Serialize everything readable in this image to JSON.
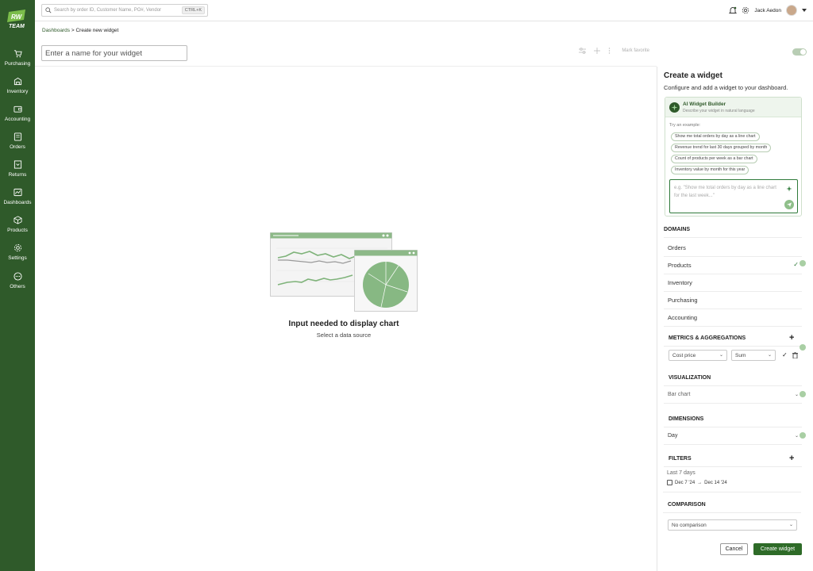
{
  "brand": {
    "logo_text_top": "RW",
    "logo_text_bottom": "TEAM",
    "accent_color": "#2f5a2a"
  },
  "sidebar": {
    "items": [
      {
        "label": "Purchasing",
        "icon": "cart-icon"
      },
      {
        "label": "Inventory",
        "icon": "box-icon"
      },
      {
        "label": "Accounting",
        "icon": "wallet-icon"
      },
      {
        "label": "Orders",
        "icon": "orders-icon"
      },
      {
        "label": "Returns",
        "icon": "returns-icon"
      },
      {
        "label": "Dashboards",
        "icon": "dashboard-icon"
      },
      {
        "label": "Products",
        "icon": "cube-icon"
      },
      {
        "label": "Settings",
        "icon": "gear-icon"
      },
      {
        "label": "Others",
        "icon": "more-icon"
      }
    ]
  },
  "topbar": {
    "search_placeholder": "Search by order ID, Customer Name, PO#, Vendor",
    "shortcut": "CTRL+K",
    "user_name": "Jack Aedon"
  },
  "breadcrumb": {
    "root": "Dashboards",
    "separator": ">",
    "current": "Create new widget"
  },
  "canvas": {
    "name_placeholder": "Enter a name for your widget",
    "mark_favorite": "Mark favorite",
    "empty_title": "Input needed to display chart",
    "empty_subtitle": "Select a data source"
  },
  "panel": {
    "title": "Create a widget",
    "subtitle": "Configure and add a widget to your dashboard.",
    "ai": {
      "title": "AI Widget Builder",
      "description": "Describe your widget in natural language",
      "try_label": "Try an example:",
      "examples": [
        "Show me total orders by day as a line chart",
        "Revenue trend for last 30 days grouped by month",
        "Count of products per week as a bar chart",
        "Inventory value by month for this year"
      ],
      "input_placeholder": "e.g. \"Show me total orders by day as a line chart for the last week...\""
    },
    "domains": {
      "heading": "DOMAINS",
      "items": [
        "Orders",
        "Products",
        "Inventory",
        "Purchasing",
        "Accounting"
      ],
      "selected": "Products"
    },
    "metrics": {
      "heading": "METRICS & AGGREGATIONS",
      "metric": "Cost price",
      "aggregation": "Sum"
    },
    "visualization": {
      "heading": "VISUALIZATION",
      "value": "Bar chart"
    },
    "dimensions": {
      "heading": "DIMENSIONS",
      "value": "Day"
    },
    "filters": {
      "heading": "FILTERS",
      "preset": "Last 7 days",
      "start": "Dec 7 '24",
      "arrow": "→",
      "end": "Dec 14 '24"
    },
    "comparison": {
      "heading": "COMPARISON",
      "value": "No comparison"
    },
    "cancel_label": "Cancel",
    "create_label": "Create widget"
  }
}
